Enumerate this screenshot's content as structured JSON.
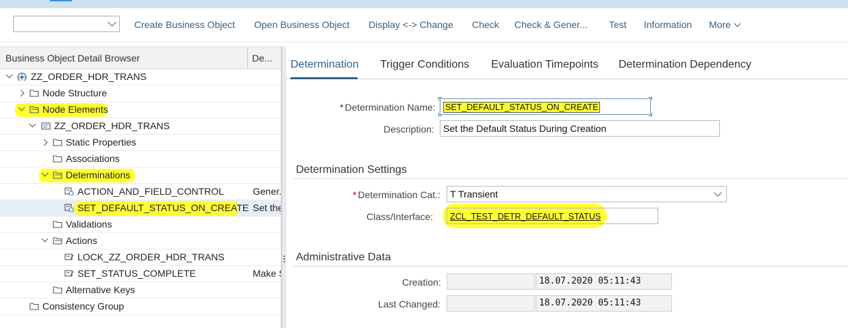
{
  "toolbar": {
    "dropdown_value": "",
    "buttons": [
      "Create Business Object",
      "Open Business Object",
      "Display <-> Change",
      "Check",
      "Check & Gener...",
      "Test",
      "Information",
      "More"
    ]
  },
  "browser": {
    "header_title": "Business Object Detail Browser",
    "header_col2": "De...",
    "rows": [
      {
        "label": "ZZ_ORDER_HDR_TRANS",
        "desc": ""
      },
      {
        "label": "Node Structure",
        "desc": ""
      },
      {
        "label": "Node Elements",
        "desc": ""
      },
      {
        "label": "ZZ_ORDER_HDR_TRANS",
        "desc": ""
      },
      {
        "label": "Static Properties",
        "desc": ""
      },
      {
        "label": "Associations",
        "desc": ""
      },
      {
        "label": "Determinations",
        "desc": ""
      },
      {
        "label": "ACTION_AND_FIELD_CONTROL",
        "desc": "Gener..."
      },
      {
        "label": "SET_DEFAULT_STATUS_ON_CREATE",
        "desc": "Set the"
      },
      {
        "label": "Validations",
        "desc": ""
      },
      {
        "label": "Actions",
        "desc": ""
      },
      {
        "label": "LOCK_ZZ_ORDER_HDR_TRANS",
        "desc": ""
      },
      {
        "label": "SET_STATUS_COMPLETE",
        "desc": "Make S"
      },
      {
        "label": "Alternative Keys",
        "desc": ""
      },
      {
        "label": "Consistency Group",
        "desc": ""
      }
    ]
  },
  "tabs": [
    "Determination",
    "Trigger Conditions",
    "Evaluation Timepoints",
    "Determination Dependency"
  ],
  "form": {
    "name_label": "Determination Name:",
    "name_value": "SET_DEFAULT_STATUS_ON_CREATE",
    "desc_label": "Description:",
    "desc_value": "Set the Default Status During Creation",
    "settings_title": "Determination Settings",
    "cat_label": "Determination Cat.:",
    "cat_value": "T Transient",
    "class_label": "Class/Interface:",
    "class_value": "ZCL_TEST_DETR_DEFAULT_STATUS",
    "admin_title": "Administrative Data",
    "creation_label": "Creation:",
    "creation_date": "18.07.2020 05:11:43",
    "changed_label": "Last Changed:",
    "changed_date": "18.07.2020 05:11:43",
    "required_mark": "*"
  },
  "colors": {
    "accent": "#346187",
    "highlight": "#ffff33",
    "required": "#cc0000"
  }
}
